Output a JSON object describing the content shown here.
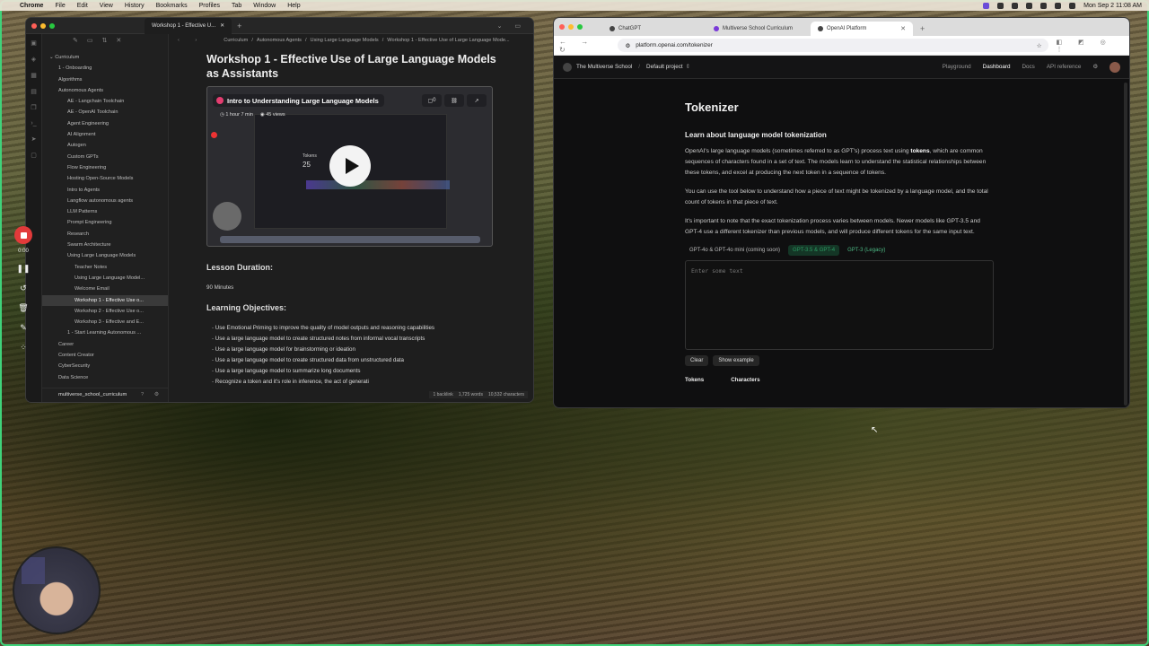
{
  "menubar": {
    "app": "Chrome",
    "items": [
      "File",
      "Edit",
      "View",
      "History",
      "Bookmarks",
      "Profiles",
      "Tab",
      "Window",
      "Help"
    ],
    "datetime": "Mon Sep 2  11:08 AM"
  },
  "left_window": {
    "tab_title": "Workshop 1 - Effective U...",
    "sidebar": {
      "root": "Curriculum",
      "items": [
        "1 - Onboarding",
        "Algorithms",
        "Autonomous Agents",
        "AE - Langchain Toolchain",
        "AE - OpenAI Toolchain",
        "Agent Engineering",
        "AI Alignment",
        "Autogen",
        "Custom GPTs",
        "Flow Engineering",
        "Hosting Open-Source Models",
        "Intro to Agents",
        "Langflow autonomous agents",
        "LLM Patterns",
        "Prompt Engineering",
        "Research",
        "Swarm Architecture",
        "Using Large Language Models",
        "Teacher Notes",
        "Using Large Language Model...",
        "Welcome Email",
        "Workshop 1 - Effective Use o...",
        "Workshop 2 - Effective Use o...",
        "Workshop 3 - Effective and E...",
        "1 - Start Learning Autonomous ...",
        "Career",
        "Content Creator",
        "CyberSecurity",
        "Data Science"
      ],
      "vault": "multiverse_school_curriculum"
    },
    "breadcrumb": [
      "Curriculum",
      "Autonomous Agents",
      "Using Large Language Models",
      "Workshop 1 - Effective Use of Large Language Mode..."
    ],
    "note": {
      "title": "Workshop 1 - Effective Use of Large Language Models as Assistants",
      "video": {
        "title": "Intro to Understanding Large Language Models",
        "duration": "1 hour 7 min",
        "views": "45 views",
        "comments": "0",
        "tokens_label": "Tokens",
        "tokens_value": "25"
      },
      "duration_heading": "Lesson Duration:",
      "duration_value": "90 Minutes",
      "objectives_heading": "Learning Objectives:",
      "objectives": [
        "Use Emotional Priming to improve the quality of model outputs and reasoning capabilities",
        "Use a large language model to create structured notes from informal vocal transcripts",
        "Use a large language model for brainstorming or ideation",
        "Use a large language model to create structured data from unstructured data",
        "Use a large language model to summarize long documents",
        "Recognize a token and it's role in inference, the act of generati"
      ],
      "status": [
        "1 backlink",
        "1,725 words",
        "10,532 characters"
      ]
    }
  },
  "recorder": {
    "time": "0:00"
  },
  "right_window": {
    "tabs": [
      {
        "label": "ChatGPT"
      },
      {
        "label": "Multiverse School Curriculum"
      },
      {
        "label": "OpenAI Platform"
      }
    ],
    "url": "platform.openai.com/tokenizer",
    "header": {
      "org": "The Multiverse School",
      "project": "Default project",
      "links": [
        "Playground",
        "Dashboard",
        "Docs",
        "API reference"
      ]
    },
    "tokenizer": {
      "title": "Tokenizer",
      "subtitle": "Learn about language model tokenization",
      "para1_a": "OpenAI's large language models (sometimes referred to as GPT's) process text using ",
      "para1_b": "tokens",
      "para1_c": ", which are common sequences of characters found in a set of text. The models learn to understand the statistical relationships between these tokens, and excel at producing the next token in a sequence of tokens.",
      "para2": "You can use the tool below to understand how a piece of text might be tokenized by a language model, and the total count of tokens in that piece of text.",
      "para3": "It's important to note that the exact tokenization process varies between models. Newer models like GPT-3.5 and GPT-4 use a different tokenizer than previous models, and will produce different tokens for the same input text.",
      "models": [
        "GPT-4o & GPT-4o mini (coming soon)",
        "GPT-3.5 & GPT-4",
        "GPT-3 (Legacy)"
      ],
      "placeholder": "Enter some text",
      "clear": "Clear",
      "show_example": "Show example",
      "stats": [
        "Tokens",
        "Characters"
      ]
    }
  },
  "colors": {
    "accent_green": "#2c9a62",
    "record_red": "#e23a3a",
    "frame": "#3fd27a"
  }
}
